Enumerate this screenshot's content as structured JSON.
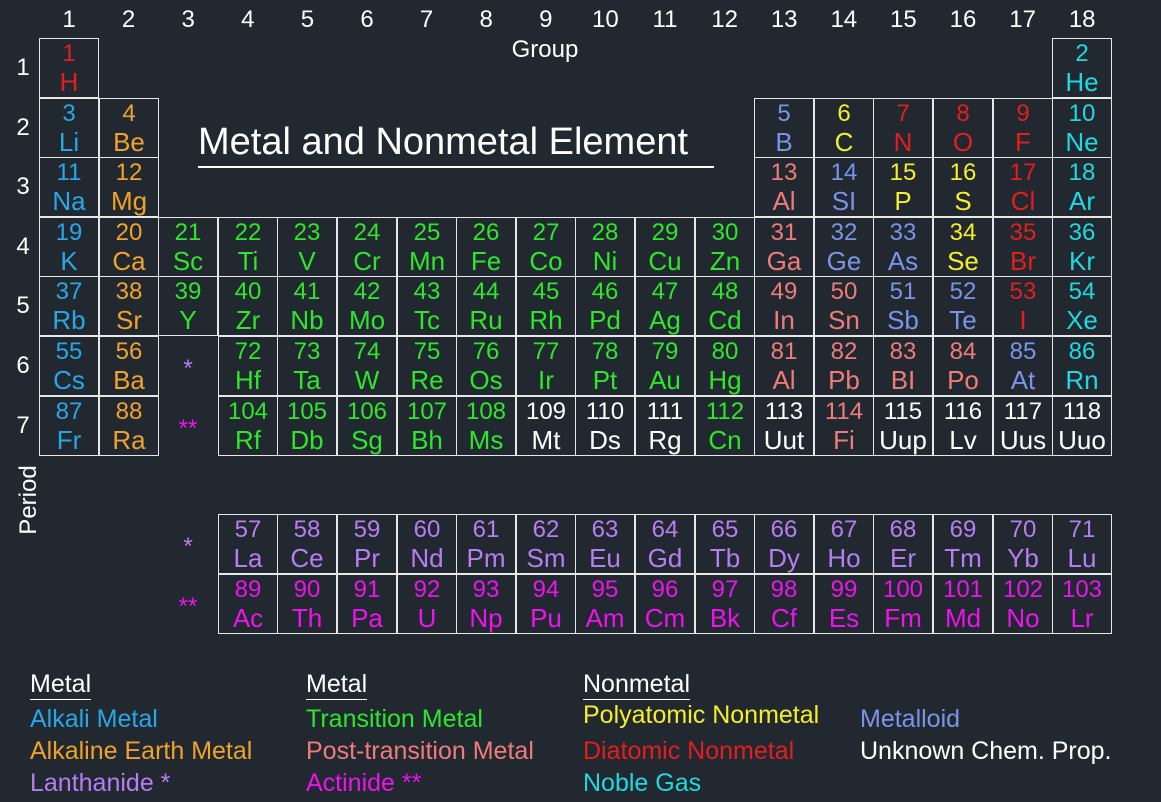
{
  "title": "Metal and Nonmetal Element",
  "axis": {
    "group_label": "Group",
    "period_label": "Period"
  },
  "groups": [
    "1",
    "2",
    "3",
    "4",
    "5",
    "6",
    "7",
    "8",
    "9",
    "10",
    "11",
    "12",
    "13",
    "14",
    "15",
    "16",
    "17",
    "18"
  ],
  "periods": [
    "1",
    "2",
    "3",
    "4",
    "5",
    "6",
    "7"
  ],
  "markers": {
    "lanthanide": "*",
    "actinide": "**"
  },
  "colors": {
    "alkali": "#2aa6e6",
    "alkaline": "#f0a22a",
    "transition": "#2ee62a",
    "post": "#f07c7a",
    "metalloid": "#7b93e8",
    "polyatomic": "#f4ef2a",
    "diatomic": "#e41e1e",
    "noble": "#1fd8e0",
    "lanthanide": "#b67ef0",
    "actinide": "#ec14ec",
    "unknown": "#ffffff"
  },
  "elements": [
    {
      "num": "1",
      "sym": "H",
      "cat": "diatomic",
      "group": 1,
      "period": 1
    },
    {
      "num": "2",
      "sym": "He",
      "cat": "noble",
      "group": 18,
      "period": 1
    },
    {
      "num": "3",
      "sym": "Li",
      "cat": "alkali",
      "group": 1,
      "period": 2
    },
    {
      "num": "4",
      "sym": "Be",
      "cat": "alkaline",
      "group": 2,
      "period": 2
    },
    {
      "num": "5",
      "sym": "B",
      "cat": "metalloid",
      "group": 13,
      "period": 2
    },
    {
      "num": "6",
      "sym": "C",
      "cat": "polyatomic",
      "group": 14,
      "period": 2
    },
    {
      "num": "7",
      "sym": "N",
      "cat": "diatomic",
      "group": 15,
      "period": 2
    },
    {
      "num": "8",
      "sym": "O",
      "cat": "diatomic",
      "group": 16,
      "period": 2
    },
    {
      "num": "9",
      "sym": "F",
      "cat": "diatomic",
      "group": 17,
      "period": 2
    },
    {
      "num": "10",
      "sym": "Ne",
      "cat": "noble",
      "group": 18,
      "period": 2
    },
    {
      "num": "11",
      "sym": "Na",
      "cat": "alkali",
      "group": 1,
      "period": 3
    },
    {
      "num": "12",
      "sym": "Mg",
      "cat": "alkaline",
      "group": 2,
      "period": 3
    },
    {
      "num": "13",
      "sym": "Al",
      "cat": "post",
      "group": 13,
      "period": 3
    },
    {
      "num": "14",
      "sym": "SI",
      "cat": "metalloid",
      "group": 14,
      "period": 3
    },
    {
      "num": "15",
      "sym": "P",
      "cat": "polyatomic",
      "group": 15,
      "period": 3
    },
    {
      "num": "16",
      "sym": "S",
      "cat": "polyatomic",
      "group": 16,
      "period": 3
    },
    {
      "num": "17",
      "sym": "Cl",
      "cat": "diatomic",
      "group": 17,
      "period": 3
    },
    {
      "num": "18",
      "sym": "Ar",
      "cat": "noble",
      "group": 18,
      "period": 3
    },
    {
      "num": "19",
      "sym": "K",
      "cat": "alkali",
      "group": 1,
      "period": 4
    },
    {
      "num": "20",
      "sym": "Ca",
      "cat": "alkaline",
      "group": 2,
      "period": 4
    },
    {
      "num": "21",
      "sym": "Sc",
      "cat": "transition",
      "group": 3,
      "period": 4
    },
    {
      "num": "22",
      "sym": "Ti",
      "cat": "transition",
      "group": 4,
      "period": 4
    },
    {
      "num": "23",
      "sym": "V",
      "cat": "transition",
      "group": 5,
      "period": 4
    },
    {
      "num": "24",
      "sym": "Cr",
      "cat": "transition",
      "group": 6,
      "period": 4
    },
    {
      "num": "25",
      "sym": "Mn",
      "cat": "transition",
      "group": 7,
      "period": 4
    },
    {
      "num": "26",
      "sym": "Fe",
      "cat": "transition",
      "group": 8,
      "period": 4
    },
    {
      "num": "27",
      "sym": "Co",
      "cat": "transition",
      "group": 9,
      "period": 4
    },
    {
      "num": "28",
      "sym": "Ni",
      "cat": "transition",
      "group": 10,
      "period": 4
    },
    {
      "num": "29",
      "sym": "Cu",
      "cat": "transition",
      "group": 11,
      "period": 4
    },
    {
      "num": "30",
      "sym": "Zn",
      "cat": "transition",
      "group": 12,
      "period": 4
    },
    {
      "num": "31",
      "sym": "Ga",
      "cat": "post",
      "group": 13,
      "period": 4
    },
    {
      "num": "32",
      "sym": "Ge",
      "cat": "metalloid",
      "group": 14,
      "period": 4
    },
    {
      "num": "33",
      "sym": "As",
      "cat": "metalloid",
      "group": 15,
      "period": 4
    },
    {
      "num": "34",
      "sym": "Se",
      "cat": "polyatomic",
      "group": 16,
      "period": 4
    },
    {
      "num": "35",
      "sym": "Br",
      "cat": "diatomic",
      "group": 17,
      "period": 4
    },
    {
      "num": "36",
      "sym": "Kr",
      "cat": "noble",
      "group": 18,
      "period": 4
    },
    {
      "num": "37",
      "sym": "Rb",
      "cat": "alkali",
      "group": 1,
      "period": 5
    },
    {
      "num": "38",
      "sym": "Sr",
      "cat": "alkaline",
      "group": 2,
      "period": 5
    },
    {
      "num": "39",
      "sym": "Y",
      "cat": "transition",
      "group": 3,
      "period": 5
    },
    {
      "num": "40",
      "sym": "Zr",
      "cat": "transition",
      "group": 4,
      "period": 5
    },
    {
      "num": "41",
      "sym": "Nb",
      "cat": "transition",
      "group": 5,
      "period": 5
    },
    {
      "num": "42",
      "sym": "Mo",
      "cat": "transition",
      "group": 6,
      "period": 5
    },
    {
      "num": "43",
      "sym": "Tc",
      "cat": "transition",
      "group": 7,
      "period": 5
    },
    {
      "num": "44",
      "sym": "Ru",
      "cat": "transition",
      "group": 8,
      "period": 5
    },
    {
      "num": "45",
      "sym": "Rh",
      "cat": "transition",
      "group": 9,
      "period": 5
    },
    {
      "num": "46",
      "sym": "Pd",
      "cat": "transition",
      "group": 10,
      "period": 5
    },
    {
      "num": "47",
      "sym": "Ag",
      "cat": "transition",
      "group": 11,
      "period": 5
    },
    {
      "num": "48",
      "sym": "Cd",
      "cat": "transition",
      "group": 12,
      "period": 5
    },
    {
      "num": "49",
      "sym": "In",
      "cat": "post",
      "group": 13,
      "period": 5
    },
    {
      "num": "50",
      "sym": "Sn",
      "cat": "post",
      "group": 14,
      "period": 5
    },
    {
      "num": "51",
      "sym": "Sb",
      "cat": "metalloid",
      "group": 15,
      "period": 5
    },
    {
      "num": "52",
      "sym": "Te",
      "cat": "metalloid",
      "group": 16,
      "period": 5
    },
    {
      "num": "53",
      "sym": "I",
      "cat": "diatomic",
      "group": 17,
      "period": 5
    },
    {
      "num": "54",
      "sym": "Xe",
      "cat": "noble",
      "group": 18,
      "period": 5
    },
    {
      "num": "55",
      "sym": "Cs",
      "cat": "alkali",
      "group": 1,
      "period": 6
    },
    {
      "num": "56",
      "sym": "Ba",
      "cat": "alkaline",
      "group": 2,
      "period": 6
    },
    {
      "num": "72",
      "sym": "Hf",
      "cat": "transition",
      "group": 4,
      "period": 6
    },
    {
      "num": "73",
      "sym": "Ta",
      "cat": "transition",
      "group": 5,
      "period": 6
    },
    {
      "num": "74",
      "sym": "W",
      "cat": "transition",
      "group": 6,
      "period": 6
    },
    {
      "num": "75",
      "sym": "Re",
      "cat": "transition",
      "group": 7,
      "period": 6
    },
    {
      "num": "76",
      "sym": "Os",
      "cat": "transition",
      "group": 8,
      "period": 6
    },
    {
      "num": "77",
      "sym": "Ir",
      "cat": "transition",
      "group": 9,
      "period": 6
    },
    {
      "num": "78",
      "sym": "Pt",
      "cat": "transition",
      "group": 10,
      "period": 6
    },
    {
      "num": "79",
      "sym": "Au",
      "cat": "transition",
      "group": 11,
      "period": 6
    },
    {
      "num": "80",
      "sym": "Hg",
      "cat": "transition",
      "group": 12,
      "period": 6
    },
    {
      "num": "81",
      "sym": "Al",
      "cat": "post",
      "group": 13,
      "period": 6
    },
    {
      "num": "82",
      "sym": "Pb",
      "cat": "post",
      "group": 14,
      "period": 6
    },
    {
      "num": "83",
      "sym": "BI",
      "cat": "post",
      "group": 15,
      "period": 6
    },
    {
      "num": "84",
      "sym": "Po",
      "cat": "post",
      "group": 16,
      "period": 6
    },
    {
      "num": "85",
      "sym": "At",
      "cat": "metalloid",
      "group": 17,
      "period": 6
    },
    {
      "num": "86",
      "sym": "Rn",
      "cat": "noble",
      "group": 18,
      "period": 6
    },
    {
      "num": "87",
      "sym": "Fr",
      "cat": "alkali",
      "group": 1,
      "period": 7
    },
    {
      "num": "88",
      "sym": "Ra",
      "cat": "alkaline",
      "group": 2,
      "period": 7
    },
    {
      "num": "104",
      "sym": "Rf",
      "cat": "transition",
      "group": 4,
      "period": 7
    },
    {
      "num": "105",
      "sym": "Db",
      "cat": "transition",
      "group": 5,
      "period": 7
    },
    {
      "num": "106",
      "sym": "Sg",
      "cat": "transition",
      "group": 6,
      "period": 7
    },
    {
      "num": "107",
      "sym": "Bh",
      "cat": "transition",
      "group": 7,
      "period": 7
    },
    {
      "num": "108",
      "sym": "Ms",
      "cat": "transition",
      "group": 8,
      "period": 7
    },
    {
      "num": "109",
      "sym": "Mt",
      "cat": "unknown",
      "group": 9,
      "period": 7
    },
    {
      "num": "110",
      "sym": "Ds",
      "cat": "unknown",
      "group": 10,
      "period": 7
    },
    {
      "num": "111",
      "sym": "Rg",
      "cat": "unknown",
      "group": 11,
      "period": 7
    },
    {
      "num": "112",
      "sym": "Cn",
      "cat": "transition",
      "group": 12,
      "period": 7
    },
    {
      "num": "113",
      "sym": "Uut",
      "cat": "unknown",
      "group": 13,
      "period": 7
    },
    {
      "num": "114",
      "sym": "Fi",
      "cat": "post",
      "group": 14,
      "period": 7
    },
    {
      "num": "115",
      "sym": "Uup",
      "cat": "unknown",
      "group": 15,
      "period": 7
    },
    {
      "num": "116",
      "sym": "Lv",
      "cat": "unknown",
      "group": 16,
      "period": 7
    },
    {
      "num": "117",
      "sym": "Uus",
      "cat": "unknown",
      "group": 17,
      "period": 7
    },
    {
      "num": "118",
      "sym": "Uuo",
      "cat": "unknown",
      "group": 18,
      "period": 7
    },
    {
      "num": "57",
      "sym": "La",
      "cat": "lanthanide",
      "group": 4,
      "period": 8
    },
    {
      "num": "58",
      "sym": "Ce",
      "cat": "lanthanide",
      "group": 5,
      "period": 8
    },
    {
      "num": "59",
      "sym": "Pr",
      "cat": "lanthanide",
      "group": 6,
      "period": 8
    },
    {
      "num": "60",
      "sym": "Nd",
      "cat": "lanthanide",
      "group": 7,
      "period": 8
    },
    {
      "num": "61",
      "sym": "Pm",
      "cat": "lanthanide",
      "group": 8,
      "period": 8
    },
    {
      "num": "62",
      "sym": "Sm",
      "cat": "lanthanide",
      "group": 9,
      "period": 8
    },
    {
      "num": "63",
      "sym": "Eu",
      "cat": "lanthanide",
      "group": 10,
      "period": 8
    },
    {
      "num": "64",
      "sym": "Gd",
      "cat": "lanthanide",
      "group": 11,
      "period": 8
    },
    {
      "num": "65",
      "sym": "Tb",
      "cat": "lanthanide",
      "group": 12,
      "period": 8
    },
    {
      "num": "66",
      "sym": "Dy",
      "cat": "lanthanide",
      "group": 13,
      "period": 8
    },
    {
      "num": "67",
      "sym": "Ho",
      "cat": "lanthanide",
      "group": 14,
      "period": 8
    },
    {
      "num": "68",
      "sym": "Er",
      "cat": "lanthanide",
      "group": 15,
      "period": 8
    },
    {
      "num": "69",
      "sym": "Tm",
      "cat": "lanthanide",
      "group": 16,
      "period": 8
    },
    {
      "num": "70",
      "sym": "Yb",
      "cat": "lanthanide",
      "group": 17,
      "period": 8
    },
    {
      "num": "71",
      "sym": "Lu",
      "cat": "lanthanide",
      "group": 18,
      "period": 8
    },
    {
      "num": "89",
      "sym": "Ac",
      "cat": "actinide",
      "group": 4,
      "period": 9
    },
    {
      "num": "90",
      "sym": "Th",
      "cat": "actinide",
      "group": 5,
      "period": 9
    },
    {
      "num": "91",
      "sym": "Pa",
      "cat": "actinide",
      "group": 6,
      "period": 9
    },
    {
      "num": "92",
      "sym": "U",
      "cat": "actinide",
      "group": 7,
      "period": 9
    },
    {
      "num": "93",
      "sym": "Np",
      "cat": "actinide",
      "group": 8,
      "period": 9
    },
    {
      "num": "94",
      "sym": "Pu",
      "cat": "actinide",
      "group": 9,
      "period": 9
    },
    {
      "num": "95",
      "sym": "Am",
      "cat": "actinide",
      "group": 10,
      "period": 9
    },
    {
      "num": "96",
      "sym": "Cm",
      "cat": "actinide",
      "group": 11,
      "period": 9
    },
    {
      "num": "97",
      "sym": "Bk",
      "cat": "actinide",
      "group": 12,
      "period": 9
    },
    {
      "num": "98",
      "sym": "Cf",
      "cat": "actinide",
      "group": 13,
      "period": 9
    },
    {
      "num": "99",
      "sym": "Es",
      "cat": "actinide",
      "group": 14,
      "period": 9
    },
    {
      "num": "100",
      "sym": "Fm",
      "cat": "actinide",
      "group": 15,
      "period": 9
    },
    {
      "num": "101",
      "sym": "Md",
      "cat": "actinide",
      "group": 16,
      "period": 9
    },
    {
      "num": "102",
      "sym": "No",
      "cat": "actinide",
      "group": 17,
      "period": 9
    },
    {
      "num": "103",
      "sym": "Lr",
      "cat": "actinide",
      "group": 18,
      "period": 9
    }
  ],
  "legend": {
    "metal_heading_1": "Metal",
    "metal_heading_2": "Metal",
    "nonmetal_heading": "Nonmetal",
    "alkali": "Alkali Metal",
    "alkaline": "Alkaline Earth Metal",
    "lanthanide": "Lanthanide *",
    "transition": "Transition Metal",
    "post": "Post-transition Metal",
    "actinide": "Actinide **",
    "polyatomic": "Polyatomic Nonmetal",
    "diatomic": "Diatomic Nonmetal",
    "noble": "Noble Gas",
    "metalloid": "Metalloid",
    "unknown": "Unknown Chem. Prop."
  }
}
